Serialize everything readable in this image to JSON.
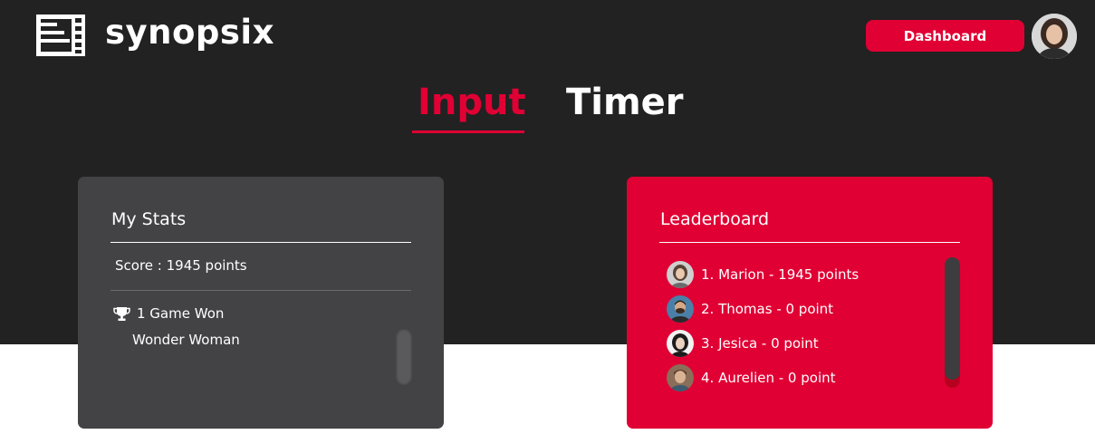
{
  "header": {
    "logo_text": "synopsix",
    "dashboard_label": "Dashboard"
  },
  "tabs": [
    {
      "label": "Input",
      "active": true
    },
    {
      "label": "Timer",
      "active": false
    }
  ],
  "stats": {
    "title": "My Stats",
    "score": "Score : 1945 points",
    "games_won": "1 Game Won",
    "movie": "Wonder Woman"
  },
  "leaderboard": {
    "title": "Leaderboard",
    "entries": [
      {
        "label": "1. Marion - 1945 points",
        "avatar": "avatar-marion"
      },
      {
        "label": "2. Thomas - 0 point",
        "avatar": "avatar-thomas"
      },
      {
        "label": "3. Jesica - 0 point",
        "avatar": "avatar-jesica"
      },
      {
        "label": "4. Aurelien - 0 point",
        "avatar": "avatar-aurelien"
      }
    ]
  },
  "colors": {
    "accent": "#e00034",
    "dark_bg": "#222222",
    "card_dark": "#434345"
  },
  "icons": [
    "film-strip-logo-icon",
    "trophy-icon",
    "user-avatar"
  ]
}
